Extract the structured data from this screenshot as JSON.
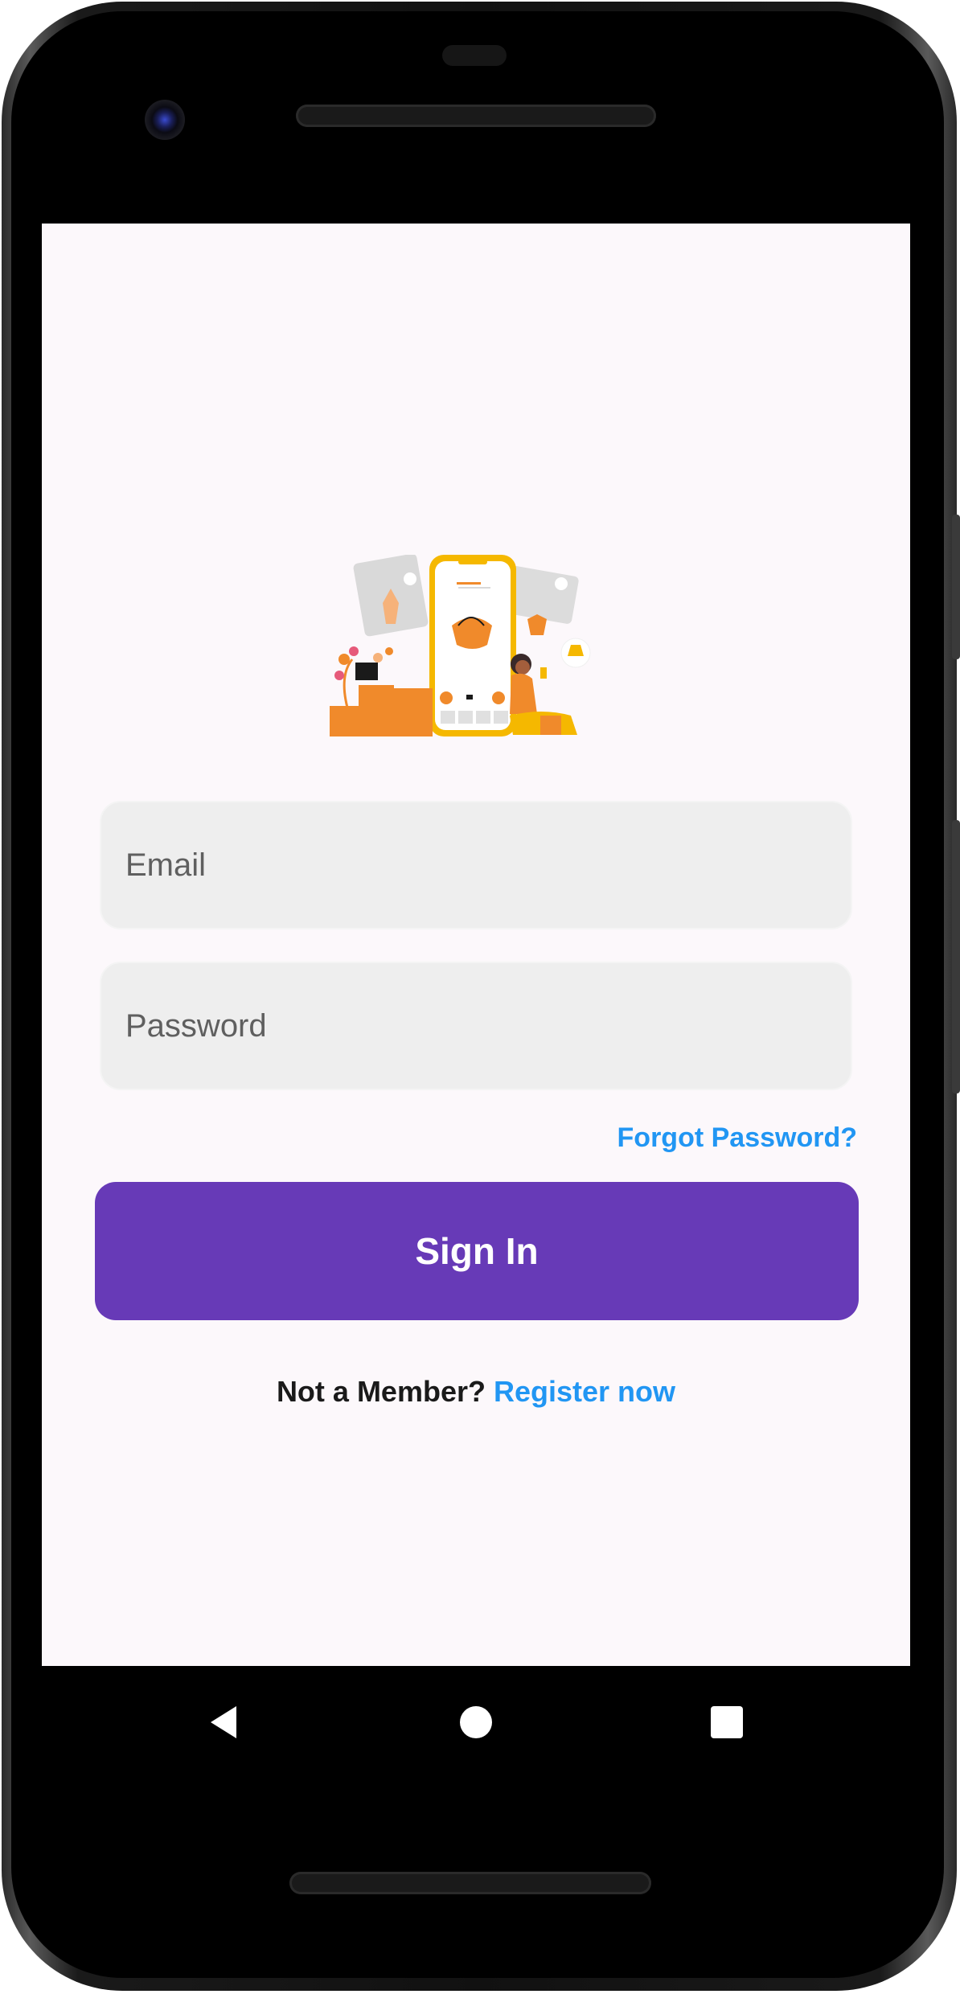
{
  "login": {
    "email_placeholder": "Email",
    "password_placeholder": "Password",
    "forgot_label": "Forgot Password?",
    "signin_label": "Sign In",
    "not_member_text": "Not a Member?",
    "register_label": "Register now"
  },
  "colors": {
    "primary": "#673ab7",
    "link": "#2196f3",
    "background": "#fcf8fb",
    "field_bg": "#eeeeee"
  },
  "navbar": {
    "icons": [
      "back-icon",
      "home-icon",
      "recents-icon"
    ]
  }
}
